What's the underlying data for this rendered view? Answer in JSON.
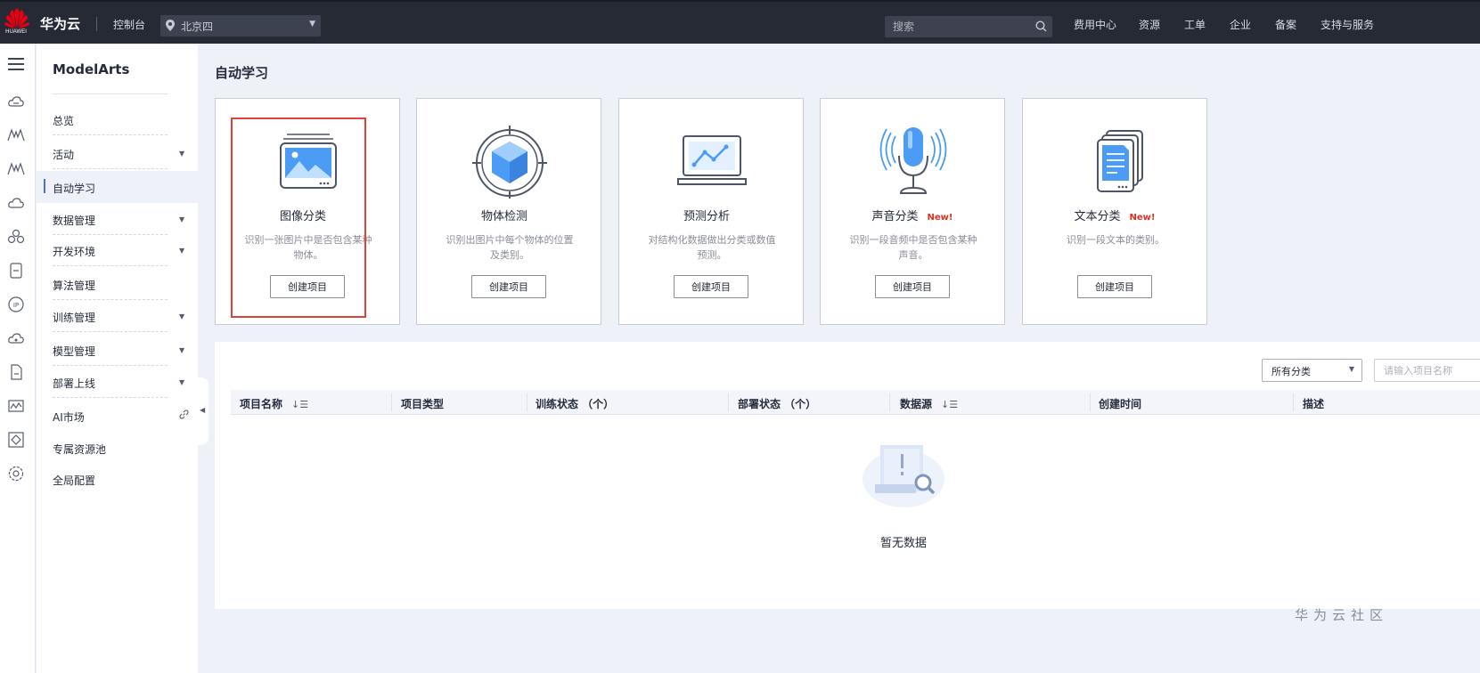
{
  "topbar": {
    "brand": "华为云",
    "logo_text": "HUAWEI",
    "console": "控制台",
    "region": "北京四",
    "search_placeholder": "搜索",
    "nav": [
      "费用中心",
      "资源",
      "工单",
      "企业",
      "备案",
      "支持与服务"
    ]
  },
  "sidebar": {
    "title": "ModelArts",
    "items": [
      {
        "label": "总览",
        "has_caret": false
      },
      {
        "label": "活动",
        "has_caret": true
      },
      {
        "label": "自动学习",
        "has_caret": false,
        "active": true
      },
      {
        "label": "数据管理",
        "has_caret": true
      },
      {
        "label": "开发环境",
        "has_caret": true
      },
      {
        "label": "算法管理",
        "has_caret": false
      },
      {
        "label": "训练管理",
        "has_caret": true
      },
      {
        "label": "模型管理",
        "has_caret": true
      },
      {
        "label": "部署上线",
        "has_caret": true
      },
      {
        "label": "AI市场",
        "has_caret": false,
        "icon": "link-icon"
      },
      {
        "label": "专属资源池",
        "has_caret": false
      },
      {
        "label": "全局配置",
        "has_caret": false
      }
    ]
  },
  "page": {
    "title": "自动学习"
  },
  "cards": [
    {
      "title": "图像分类",
      "new": "",
      "desc": "识别一张图片中是否包含某种物体。",
      "button": "创建项目",
      "icon": "image-classification-icon"
    },
    {
      "title": "物体检测",
      "new": "",
      "desc": "识别出图片中每个物体的位置及类别。",
      "button": "创建项目",
      "icon": "object-detection-icon"
    },
    {
      "title": "预测分析",
      "new": "",
      "desc": "对结构化数据做出分类或数值预测。",
      "button": "创建项目",
      "icon": "predictive-analytics-icon"
    },
    {
      "title": "声音分类",
      "new": "New!",
      "desc": "识别一段音频中是否包含某种声音。",
      "button": "创建项目",
      "icon": "sound-classification-icon"
    },
    {
      "title": "文本分类",
      "new": "New!",
      "desc": "识别一段文本的类别。",
      "button": "创建项目",
      "icon": "text-classification-icon"
    }
  ],
  "table": {
    "filter": "所有分类",
    "search_placeholder": "请输入项目名称",
    "columns": [
      "项目名称",
      "项目类型",
      "训练状态 （个）",
      "部署状态 （个）",
      "数据源",
      "创建时间",
      "描述"
    ],
    "empty_text": "暂无数据"
  },
  "watermark": "华为云社区",
  "colors": {
    "accent": "#526ecc",
    "new_badge": "#e0301e",
    "highlight": "#e0423a",
    "topbar": "#252a35"
  }
}
